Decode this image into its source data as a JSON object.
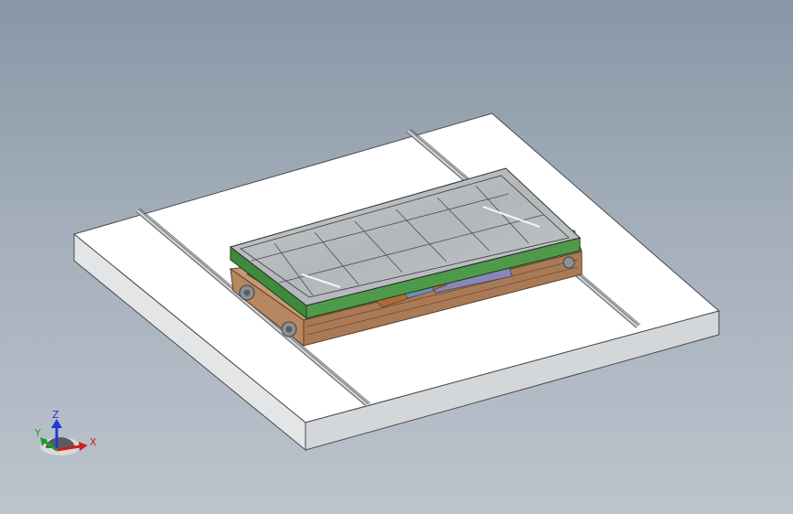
{
  "viewport": {
    "background_top": "#8a96a6",
    "background_bottom": "#bcc4cd"
  },
  "model": {
    "floor_color": "#ffffff",
    "rail_color": "#b4b8bc",
    "cart_frame_color": "#b98a62",
    "top_frame_color": "#4f9a4a",
    "cover_panel_color": "#b9bcbe",
    "actuator_color": "#8a86b8"
  },
  "triad": {
    "x_label": "X",
    "y_label": "Y",
    "z_label": "Z",
    "x_color": "#d01e1e",
    "y_color": "#1ea01e",
    "z_color": "#1e3ad0"
  }
}
